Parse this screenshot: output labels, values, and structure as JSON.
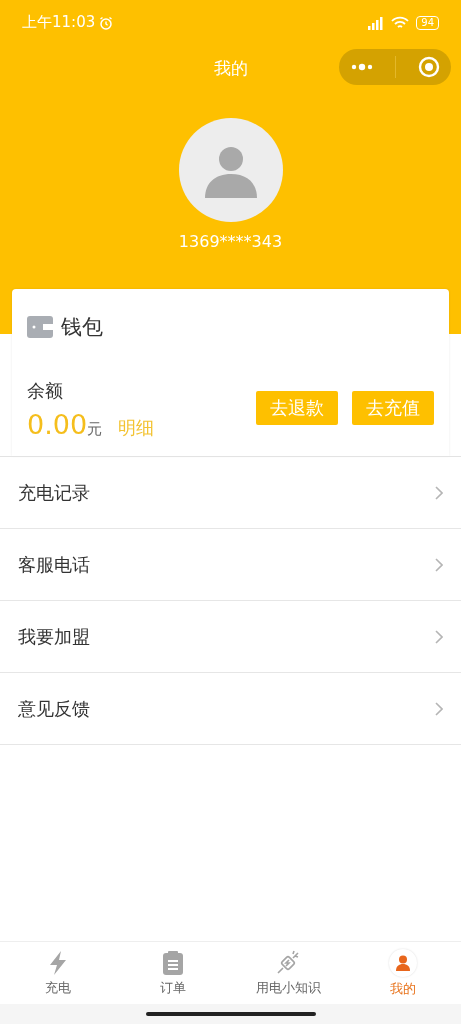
{
  "status_bar": {
    "time": "上午11:03",
    "battery": "94"
  },
  "nav": {
    "title": "我的"
  },
  "profile": {
    "phone": "1369****343"
  },
  "wallet": {
    "title": "钱包",
    "balance_label": "余额",
    "amount": "0.00",
    "unit": "元",
    "detail_link": "明细",
    "buttons": [
      "去退款",
      "去充值"
    ]
  },
  "menu": [
    {
      "label": "充电记录"
    },
    {
      "label": "客服电话"
    },
    {
      "label": "我要加盟"
    },
    {
      "label": "意见反馈"
    }
  ],
  "tabs": [
    {
      "label": "充电",
      "kind": "bolt",
      "selected": false
    },
    {
      "label": "订单",
      "kind": "clipboard",
      "selected": false
    },
    {
      "label": "用电小知识",
      "kind": "plug",
      "selected": false
    },
    {
      "label": "我的",
      "kind": "person",
      "selected": true
    }
  ]
}
